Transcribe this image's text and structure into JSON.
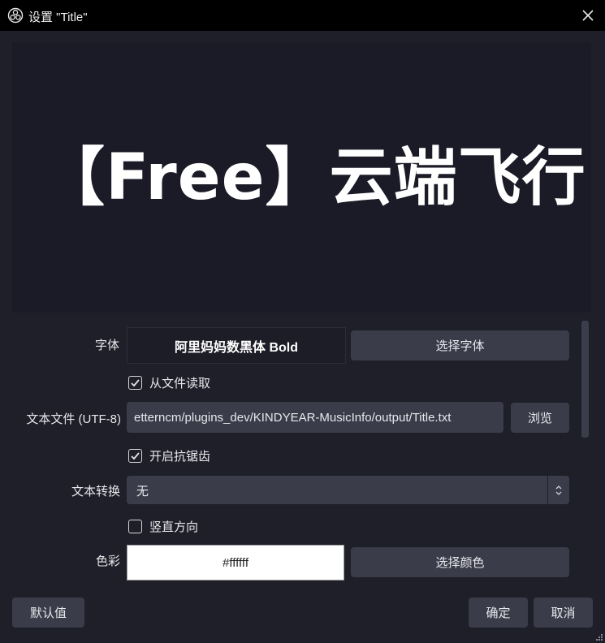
{
  "titlebar": {
    "title": "设置 \"Title\"",
    "app_icon": "obs-logo-icon",
    "close_icon": "close-icon"
  },
  "preview": {
    "text": "【Free】云端飞行"
  },
  "properties": {
    "font": {
      "label": "字体",
      "value": "阿里妈妈数黑体 Bold",
      "button": "选择字体"
    },
    "read_from_file": {
      "label": "从文件读取",
      "checked": true
    },
    "text_file": {
      "label": "文本文件 (UTF-8)",
      "value": "etterncm/plugins_dev/KINDYEAR-MusicInfo/output/Title.txt",
      "button": "浏览"
    },
    "antialiasing": {
      "label": "开启抗锯齿",
      "checked": true
    },
    "text_transform": {
      "label": "文本转换",
      "value": "无"
    },
    "vertical": {
      "label": "竖直方向",
      "checked": false
    },
    "color": {
      "label": "色彩",
      "value": "#ffffff",
      "button": "选择颜色"
    }
  },
  "footer": {
    "defaults_button": "默认值",
    "ok_button": "确定",
    "cancel_button": "取消"
  },
  "colors": {
    "background": "#1e1f28",
    "titlebar": "#000000",
    "button": "#3b3c4a",
    "preview_bg": "#1a1b26"
  }
}
